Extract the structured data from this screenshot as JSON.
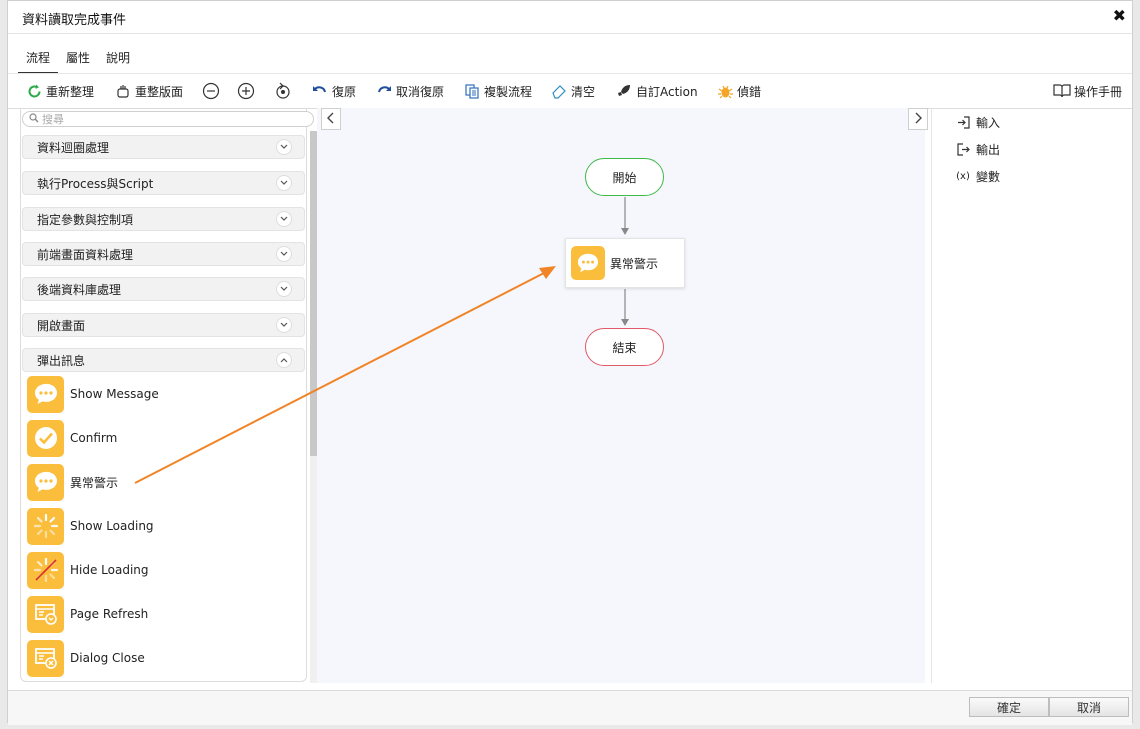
{
  "dialog": {
    "title": "資料讀取完成事件"
  },
  "tabs": [
    {
      "label": "流程"
    },
    {
      "label": "屬性"
    },
    {
      "label": "說明"
    }
  ],
  "toolbar": {
    "refresh": "重新整理",
    "relayout": "重整版面",
    "undo": "復原",
    "cancel_undo": "取消復原",
    "copy_flow": "複製流程",
    "clear": "清空",
    "custom_action": "自訂Action",
    "debug": "偵錯",
    "manual": "操作手冊"
  },
  "search": {
    "placeholder": "搜尋"
  },
  "categories": [
    {
      "label": "資料迴圈處理"
    },
    {
      "label": "執行Process與Script"
    },
    {
      "label": "指定參數與控制項"
    },
    {
      "label": "前端畫面資料處理"
    },
    {
      "label": "後端資料庫處理"
    },
    {
      "label": "開啟畫面"
    },
    {
      "label": "彈出訊息"
    }
  ],
  "items": [
    {
      "label": "Show Message",
      "icon": "chat-bubble-icon"
    },
    {
      "label": "Confirm",
      "icon": "check-circle-icon"
    },
    {
      "label": "異常警示",
      "icon": "chat-bubble-icon"
    },
    {
      "label": "Show Loading",
      "icon": "spinner-icon"
    },
    {
      "label": "Hide Loading",
      "icon": "spinner-off-icon"
    },
    {
      "label": "Page Refresh",
      "icon": "page-refresh-icon"
    },
    {
      "label": "Dialog Close",
      "icon": "dialog-close-icon"
    }
  ],
  "flow": {
    "start": "開始",
    "task": "異常警示",
    "end": "結束"
  },
  "right_panel": {
    "input": "輸入",
    "output": "輸出",
    "variable_prefix": "(x)",
    "variable": "變數"
  },
  "footer": {
    "ok": "確定",
    "cancel": "取消"
  },
  "colors": {
    "accent_orange": "#fbbd3c",
    "start_border": "#3fb949",
    "end_border": "#e05a6a",
    "arrow": "#f08426",
    "refresh_green": "#2eaa4a"
  }
}
